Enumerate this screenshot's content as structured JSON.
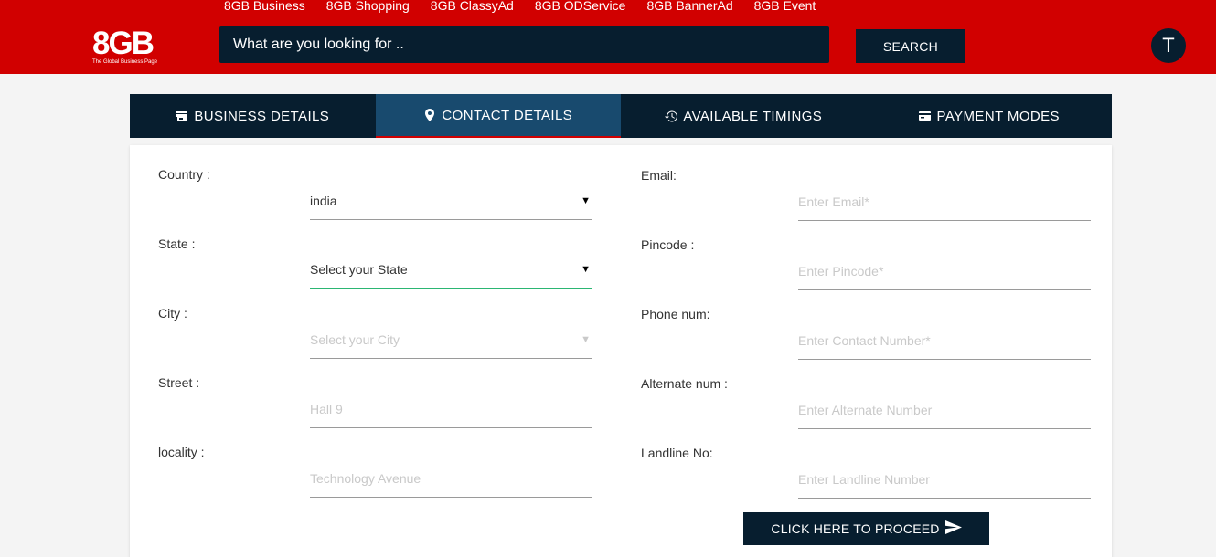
{
  "top_nav": [
    "8GB Business",
    "8GB Shopping",
    "8GB ClassyAd",
    "8GB ODService",
    "8GB BannerAd",
    "8GB Event"
  ],
  "logo": {
    "main": "8GB",
    "sub": "The Global Business Page"
  },
  "search": {
    "placeholder": "What are you looking for ..",
    "button": "SEARCH"
  },
  "avatar": "T",
  "tabs": [
    {
      "label": "BUSINESS DETAILS",
      "icon": "store-icon",
      "active": false
    },
    {
      "label": "CONTACT DETAILS",
      "icon": "location-pin-icon",
      "active": true
    },
    {
      "label": "AVAILABLE TIMINGS",
      "icon": "history-icon",
      "active": false
    },
    {
      "label": "PAYMENT MODES",
      "icon": "card-icon",
      "active": false
    }
  ],
  "left_fields": {
    "country": {
      "label": "Country :",
      "value": "india"
    },
    "state": {
      "label": "State :",
      "value": "Select your State"
    },
    "city": {
      "label": "City :",
      "placeholder": "Select your City"
    },
    "street": {
      "label": "Street :",
      "placeholder": "Hall 9"
    },
    "locality": {
      "label": "locality :",
      "placeholder": "Technology Avenue"
    }
  },
  "right_fields": {
    "email": {
      "label": "Email:",
      "placeholder": "Enter Email*"
    },
    "pincode": {
      "label": "Pincode :",
      "placeholder": "Enter Pincode*"
    },
    "phone": {
      "label": "Phone num:",
      "placeholder": "Enter Contact Number*"
    },
    "alternate": {
      "label": "Alternate num :",
      "placeholder": "Enter Alternate Number"
    },
    "landline": {
      "label": "Landline No:",
      "placeholder": "Enter Landline Number"
    }
  },
  "proceed_button": "CLICK HERE TO PROCEED",
  "colors": {
    "header_red": "#d10000",
    "navy": "#071e2f",
    "active_tab": "#184a6e",
    "focus_green": "#2bb673"
  }
}
